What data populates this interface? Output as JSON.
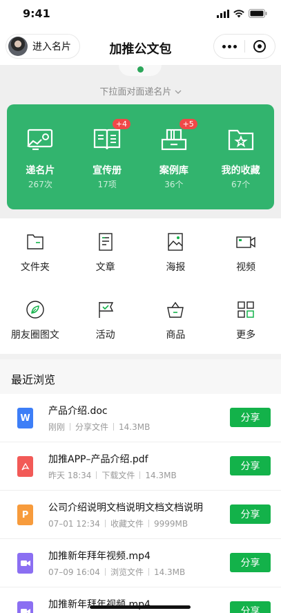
{
  "status": {
    "time": "9:41"
  },
  "nav": {
    "namecard_label": "进入名片",
    "title": "加推公文包"
  },
  "pulldown": "下拉面对面递名片",
  "card": [
    {
      "label": "递名片",
      "count": "267次",
      "badge": ""
    },
    {
      "label": "宣传册",
      "count": "17项",
      "badge": "+4"
    },
    {
      "label": "案例库",
      "count": "36个",
      "badge": "+5"
    },
    {
      "label": "我的收藏",
      "count": "67个",
      "badge": ""
    }
  ],
  "grid": [
    {
      "label": "文件夹",
      "icon": "folder-icon"
    },
    {
      "label": "文章",
      "icon": "article-icon"
    },
    {
      "label": "海报",
      "icon": "poster-icon"
    },
    {
      "label": "视频",
      "icon": "video-icon"
    },
    {
      "label": "朋友圈图文",
      "icon": "moments-icon"
    },
    {
      "label": "活动",
      "icon": "flag-icon"
    },
    {
      "label": "商品",
      "icon": "basket-icon"
    },
    {
      "label": "更多",
      "icon": "more-grid-icon"
    }
  ],
  "recent": {
    "heading": "最近浏览"
  },
  "files": [
    {
      "name": "产品介绍.doc",
      "time": "刚刚",
      "action": "分享文件",
      "size": "14.3MB",
      "type": "W",
      "color": "#3d7ef7",
      "share": "分享"
    },
    {
      "name": "加推APP–产品介绍.pdf",
      "time": "昨天 18:34",
      "action": "下载文件",
      "size": "14.3MB",
      "type": "pdf",
      "color": "#f25a57",
      "share": "分享"
    },
    {
      "name": "公司介绍说明文档说明文档文档说明",
      "time": "07–01 12:34",
      "action": "收藏文件",
      "size": "9999MB",
      "type": "P",
      "color": "#f79b3c",
      "share": "分享"
    },
    {
      "name": "加推新年拜年视频.mp4",
      "time": "07–09 16:04",
      "action": "浏览文件",
      "size": "14.3MB",
      "type": "video",
      "color": "#8b6ff2",
      "share": "分享"
    },
    {
      "name": "加推新年拜年视频.mp4",
      "time": "",
      "action": "",
      "size": "",
      "type": "video",
      "color": "#8b6ff2",
      "share": "分享"
    }
  ]
}
